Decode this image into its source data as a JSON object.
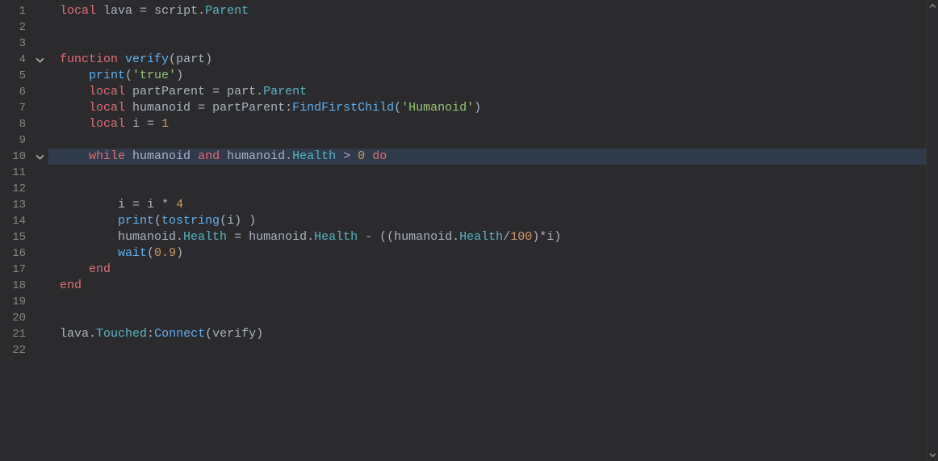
{
  "editor": {
    "total_lines": 22,
    "highlighted_line": 10,
    "fold_markers": {
      "4": "open",
      "10": "open"
    },
    "lines": {
      "1": [
        {
          "cls": "k",
          "t": "local"
        },
        {
          "cls": "op",
          "t": " "
        },
        {
          "cls": "id",
          "t": "lava"
        },
        {
          "cls": "op",
          "t": " = "
        },
        {
          "cls": "id",
          "t": "script"
        },
        {
          "cls": "op",
          "t": "."
        },
        {
          "cls": "mem",
          "t": "Parent"
        }
      ],
      "2": [],
      "3": [],
      "4": [
        {
          "cls": "k",
          "t": "function"
        },
        {
          "cls": "op",
          "t": " "
        },
        {
          "cls": "fnname",
          "t": "verify"
        },
        {
          "cls": "op",
          "t": "("
        },
        {
          "cls": "id",
          "t": "part"
        },
        {
          "cls": "op",
          "t": ")"
        }
      ],
      "5": [
        {
          "cls": "op",
          "t": "    "
        },
        {
          "cls": "call",
          "t": "print"
        },
        {
          "cls": "op",
          "t": "("
        },
        {
          "cls": "str",
          "t": "'true'"
        },
        {
          "cls": "op",
          "t": ")"
        }
      ],
      "6": [
        {
          "cls": "op",
          "t": "    "
        },
        {
          "cls": "k",
          "t": "local"
        },
        {
          "cls": "op",
          "t": " "
        },
        {
          "cls": "id",
          "t": "partParent"
        },
        {
          "cls": "op",
          "t": " = "
        },
        {
          "cls": "id",
          "t": "part"
        },
        {
          "cls": "op",
          "t": "."
        },
        {
          "cls": "mem",
          "t": "Parent"
        }
      ],
      "7": [
        {
          "cls": "op",
          "t": "    "
        },
        {
          "cls": "k",
          "t": "local"
        },
        {
          "cls": "op",
          "t": " "
        },
        {
          "cls": "id",
          "t": "humanoid"
        },
        {
          "cls": "op",
          "t": " = "
        },
        {
          "cls": "id",
          "t": "partParent"
        },
        {
          "cls": "op",
          "t": ":"
        },
        {
          "cls": "call",
          "t": "FindFirstChild"
        },
        {
          "cls": "op",
          "t": "("
        },
        {
          "cls": "str",
          "t": "'Humanoid'"
        },
        {
          "cls": "op",
          "t": ")"
        }
      ],
      "8": [
        {
          "cls": "op",
          "t": "    "
        },
        {
          "cls": "k",
          "t": "local"
        },
        {
          "cls": "op",
          "t": " "
        },
        {
          "cls": "id",
          "t": "i"
        },
        {
          "cls": "op",
          "t": " = "
        },
        {
          "cls": "num",
          "t": "1"
        }
      ],
      "9": [],
      "10": [
        {
          "cls": "op",
          "t": "    "
        },
        {
          "cls": "k",
          "t": "while"
        },
        {
          "cls": "op",
          "t": " "
        },
        {
          "cls": "id",
          "t": "humanoid"
        },
        {
          "cls": "op",
          "t": " "
        },
        {
          "cls": "k",
          "t": "and"
        },
        {
          "cls": "op",
          "t": " "
        },
        {
          "cls": "id",
          "t": "humanoid"
        },
        {
          "cls": "op",
          "t": "."
        },
        {
          "cls": "mem",
          "t": "Health"
        },
        {
          "cls": "op",
          "t": " > "
        },
        {
          "cls": "num",
          "t": "0"
        },
        {
          "cls": "op",
          "t": " "
        },
        {
          "cls": "k",
          "t": "do"
        }
      ],
      "11": [],
      "12": [],
      "13": [
        {
          "cls": "op",
          "t": "        "
        },
        {
          "cls": "id",
          "t": "i"
        },
        {
          "cls": "op",
          "t": " = "
        },
        {
          "cls": "id",
          "t": "i"
        },
        {
          "cls": "op",
          "t": " * "
        },
        {
          "cls": "num",
          "t": "4"
        }
      ],
      "14": [
        {
          "cls": "op",
          "t": "        "
        },
        {
          "cls": "call",
          "t": "print"
        },
        {
          "cls": "op",
          "t": "("
        },
        {
          "cls": "call",
          "t": "tostring"
        },
        {
          "cls": "op",
          "t": "("
        },
        {
          "cls": "id",
          "t": "i"
        },
        {
          "cls": "op",
          "t": ") )"
        }
      ],
      "15": [
        {
          "cls": "op",
          "t": "        "
        },
        {
          "cls": "id",
          "t": "humanoid"
        },
        {
          "cls": "op",
          "t": "."
        },
        {
          "cls": "mem",
          "t": "Health"
        },
        {
          "cls": "op",
          "t": " = "
        },
        {
          "cls": "id",
          "t": "humanoid"
        },
        {
          "cls": "op",
          "t": "."
        },
        {
          "cls": "mem",
          "t": "Health"
        },
        {
          "cls": "op",
          "t": " - (("
        },
        {
          "cls": "id",
          "t": "humanoid"
        },
        {
          "cls": "op",
          "t": "."
        },
        {
          "cls": "mem",
          "t": "Health"
        },
        {
          "cls": "op",
          "t": "/"
        },
        {
          "cls": "num",
          "t": "100"
        },
        {
          "cls": "op",
          "t": ")*"
        },
        {
          "cls": "id",
          "t": "i"
        },
        {
          "cls": "op",
          "t": ")"
        }
      ],
      "16": [
        {
          "cls": "op",
          "t": "        "
        },
        {
          "cls": "call",
          "t": "wait"
        },
        {
          "cls": "op",
          "t": "("
        },
        {
          "cls": "num",
          "t": "0.9"
        },
        {
          "cls": "op",
          "t": ")"
        }
      ],
      "17": [
        {
          "cls": "op",
          "t": "    "
        },
        {
          "cls": "k",
          "t": "end"
        }
      ],
      "18": [
        {
          "cls": "k",
          "t": "end"
        }
      ],
      "19": [],
      "20": [],
      "21": [
        {
          "cls": "id",
          "t": "lava"
        },
        {
          "cls": "op",
          "t": "."
        },
        {
          "cls": "mem",
          "t": "Touched"
        },
        {
          "cls": "op",
          "t": ":"
        },
        {
          "cls": "call",
          "t": "Connect"
        },
        {
          "cls": "op",
          "t": "("
        },
        {
          "cls": "id",
          "t": "verify"
        },
        {
          "cls": "op",
          "t": ")"
        }
      ],
      "22": []
    }
  }
}
